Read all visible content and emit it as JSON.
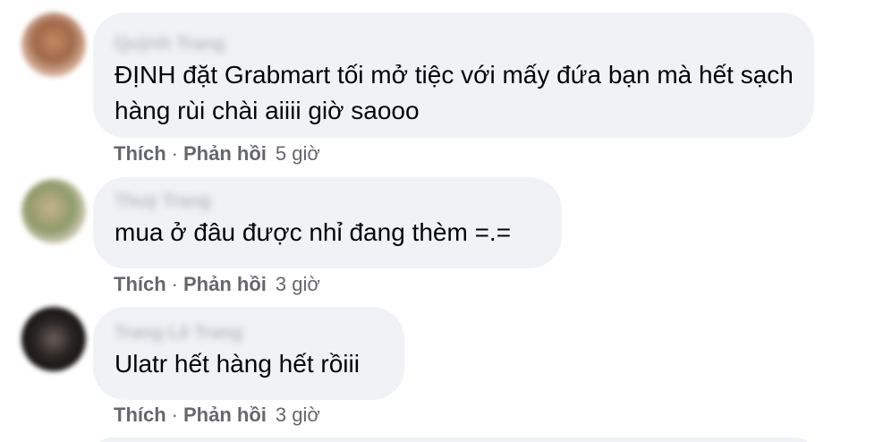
{
  "comments": [
    {
      "author": "Quỳnh Trang",
      "text": "ĐỊNH đặt Grabmart tối mở tiệc với mấy đứa bạn mà hết sạch hàng rùi chài aiiii giờ saooo",
      "like_label": "Thích",
      "reply_label": "Phản hồi",
      "time": "5 giờ"
    },
    {
      "author": "Thuỳ Trang",
      "text": "mua ở đâu được nhỉ đang thèm =.=",
      "like_label": "Thích",
      "reply_label": "Phản hồi",
      "time": "3 giờ"
    },
    {
      "author": "Trang Lê Trang",
      "text": "Ulatr hết hàng hết rồiii",
      "like_label": "Thích",
      "reply_label": "Phản hồi",
      "time": "3 giờ"
    }
  ],
  "separator": "·",
  "colors": {
    "bubble": "#f0f2f5",
    "text": "#050505",
    "meta": "#65676b"
  }
}
